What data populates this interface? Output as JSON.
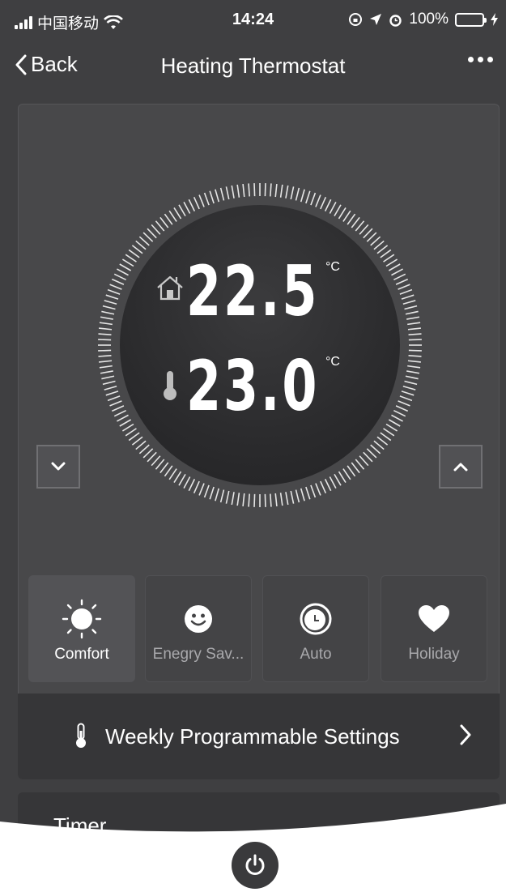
{
  "status_bar": {
    "carrier": "中国移动",
    "time": "14:24",
    "battery": "100%",
    "battery_level": 1.0
  },
  "nav": {
    "back_label": "Back",
    "title": "Heating Thermostat"
  },
  "thermostat": {
    "target_temp": "22.5",
    "current_temp": "23.0",
    "unit": "°C"
  },
  "modes": [
    {
      "label": "Comfort",
      "icon": "sun-icon",
      "active": true
    },
    {
      "label": "Enegry Sav...",
      "icon": "smiley-icon",
      "active": false
    },
    {
      "label": "Auto",
      "icon": "clock-icon",
      "active": false
    },
    {
      "label": "Holiday",
      "icon": "heart-icon",
      "active": false
    }
  ],
  "rows": {
    "weekly_label": "Weekly Programmable Settings",
    "timer_label": "Timer"
  },
  "colors": {
    "background": "#3f3f41",
    "card": "#48484a",
    "battery_fill": "#4cd964"
  }
}
